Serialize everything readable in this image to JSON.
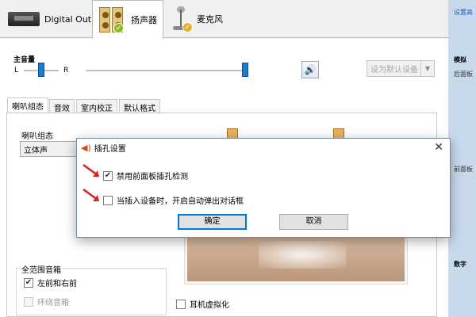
{
  "device_tabs": [
    {
      "label": "Digital Output"
    },
    {
      "label": "扬声器"
    },
    {
      "label": "麦克风"
    }
  ],
  "sidebar": {
    "items": [
      "设置高",
      "模拟",
      "后面板",
      "前面板",
      "数字"
    ]
  },
  "master_volume": {
    "label": "主音量",
    "left_label": "L",
    "right_label": "R",
    "balance_level": 0.5,
    "volume_level": 0.98,
    "set_default_label": "设为默认设备"
  },
  "inner_tabs": [
    "喇叭组态",
    "音效",
    "室内校正",
    "默认格式"
  ],
  "speaker_config": {
    "group_label": "喇叭组态",
    "selected": "立体声"
  },
  "full_range": {
    "group_label": "全范围音箱",
    "items": [
      {
        "label": "左前和右前",
        "checked": true,
        "enabled": true
      },
      {
        "label": "环绕音箱",
        "checked": false,
        "enabled": false
      }
    ]
  },
  "headphone_virtualization": {
    "label": "耳机虚拟化",
    "checked": false
  },
  "dialog": {
    "title": "插孔设置",
    "close": "✕",
    "options": [
      {
        "label": "禁用前面板插孔检测",
        "checked": true
      },
      {
        "label": "当插入设备时，开启自动弹出对话框",
        "checked": false
      }
    ],
    "ok_label": "确定",
    "cancel_label": "取消"
  },
  "colors": {
    "accent": "#0078d7",
    "sidebar": "#c9d9ec",
    "annotation_arrow": "#e02020"
  }
}
